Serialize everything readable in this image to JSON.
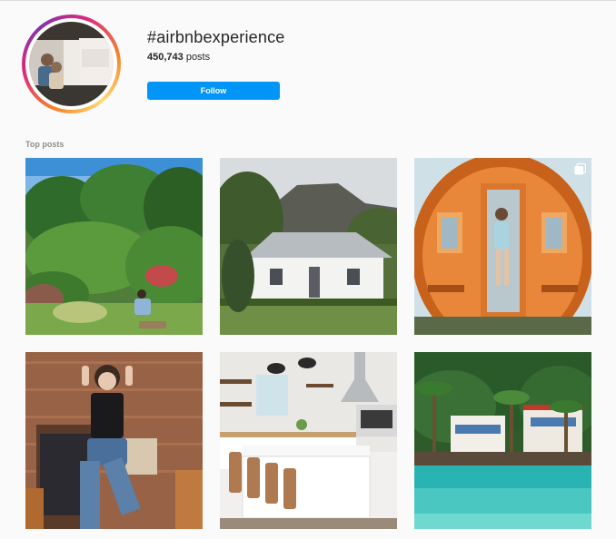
{
  "header": {
    "hashtag": "#airbnbexperience",
    "post_count": "450,743",
    "post_count_suffix": " posts",
    "follow_label": "Follow"
  },
  "sections": {
    "top_posts_label": "Top posts"
  },
  "posts": [
    {
      "name": "post-garden-woman",
      "icon": null
    },
    {
      "name": "post-white-cottage",
      "icon": null
    },
    {
      "name": "post-barrel-sauna",
      "icon": "carousel-icon"
    },
    {
      "name": "post-woman-denim",
      "icon": null
    },
    {
      "name": "post-kitchen",
      "icon": null
    },
    {
      "name": "post-tropical-resort",
      "icon": null
    }
  ],
  "colors": {
    "follow_button": "#0095f6",
    "background": "#fafafa",
    "secondary_text": "#8e8e8e"
  }
}
